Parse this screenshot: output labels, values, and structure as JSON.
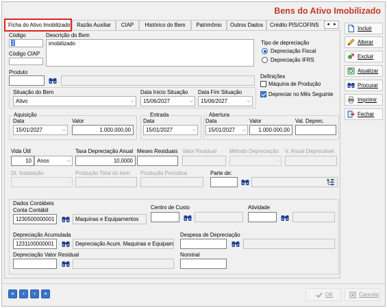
{
  "window": {
    "title": "Bens do Ativo Imobilizado"
  },
  "tabs": [
    {
      "label": "Ficha do Ativo Imobilizado",
      "active": true
    },
    {
      "label": "Razão Auxiliar"
    },
    {
      "label": "CIAP"
    },
    {
      "label": "Histórico do Bem"
    },
    {
      "label": "Patrimônio"
    },
    {
      "label": "Outros Dados"
    },
    {
      "label": "Crédito PIS/COFINS"
    }
  ],
  "tab_scroll": {
    "left": "◄",
    "right": "►"
  },
  "codigo": {
    "label": "Código",
    "value": "2"
  },
  "descricao": {
    "label": "Descrição do Bem",
    "value": "imobilizado"
  },
  "codigo_ciap": {
    "label": "Código CIAP",
    "value": ""
  },
  "produto": {
    "label": "Produto",
    "value": "",
    "desc": ""
  },
  "tipo_depreciacao": {
    "label": "Tipo de depreciação",
    "options": [
      "Depreciação Fiscal",
      "Depreciação IFRS"
    ],
    "selected": "Depreciação Fiscal"
  },
  "definicoes": {
    "label": "Definições",
    "maquina_producao": {
      "label": "Máquina de Produção",
      "checked": false
    },
    "depreciar_mes_seguinte": {
      "label": "Depreciar no Mês Seguinte",
      "checked": true
    }
  },
  "situacao": {
    "label": "Situação do Bem",
    "value": "Ativo"
  },
  "data_inicio_situacao": {
    "label": "Data Inicio Situação",
    "value": "15/06/2027"
  },
  "data_fim_situacao": {
    "label": "Data Fim Situação",
    "value": "15/06/2027"
  },
  "aquisicao": {
    "group": "Aquisição",
    "data_label": "Data",
    "data_value": "15/01/2027",
    "valor_label": "Valor",
    "valor_value": "1.000.000,00"
  },
  "entrada": {
    "group": "Entrada",
    "data_label": "Data",
    "data_value": "15/01/2027"
  },
  "abertura": {
    "group": "Abertura",
    "data_label": "Data",
    "data_value": "15/01/2027",
    "valor_label": "Valor",
    "valor_value": "1.000.000,00",
    "val_deprec_label": "Val. Deprec.",
    "val_deprec_value": ""
  },
  "depreciacao": {
    "vida_util_label": "Vida Útil",
    "vida_util_value": "10",
    "vida_util_unit": "Anos",
    "taxa_label": "Taxa Depreciação Anual",
    "taxa_value": "10,0000",
    "meses_residuais_label": "Meses Residuais",
    "valor_residual_label": "Valor Residual",
    "metodo_label": "Método Depreciação",
    "v_anual_label": "V. Anual Depreciável",
    "dt_instalacao_label": "Dt. Instalação",
    "producao_total_label": "Produção Total do bem",
    "producao_periodica_label": "Produção Periódica",
    "parte_de_label": "Parte de:"
  },
  "dados_contabeis": {
    "group": "Dados Contábeis",
    "conta_contabil_label": "Conta Contábil",
    "conta_contabil_code": "1230500000001",
    "conta_contabil_desc": "Maquinas e Equipamentos",
    "centro_custo_label": "Centro de Custo",
    "atividade_label": "Atividade",
    "dep_acumulada_label": "Depreciação Acumulada",
    "dep_acumulada_code": "1231100000001",
    "dep_acumulada_desc": "Depreciação Acum. Maquinas e Equipame",
    "despesa_dep_label": "Despesa de Depreciação",
    "dep_valor_residual_label": "Depreciação Valor Residual",
    "nominal_label": "Nominal"
  },
  "actions": [
    {
      "label": "Incluir",
      "icon": "document-icon"
    },
    {
      "label": "Alterar",
      "icon": "pencil-icon"
    },
    {
      "label": "Excluir",
      "icon": "delete-icon"
    },
    {
      "label": "Atualizar",
      "icon": "refresh-icon"
    },
    {
      "label": "Procurar",
      "icon": "binoculars-icon"
    },
    {
      "label": "Imprimir",
      "icon": "printer-icon"
    },
    {
      "label": "Fechar",
      "icon": "exit-icon"
    }
  ],
  "footer": {
    "ok_label": "OK",
    "cancel_label": "Cancela",
    "nav": [
      "«",
      "‹",
      "›",
      "»"
    ]
  },
  "colors": {
    "title": "#c0392b",
    "active_tab_border": "#e02020",
    "nav_button": "#3a73c9",
    "selection": "#3c7bd4"
  }
}
